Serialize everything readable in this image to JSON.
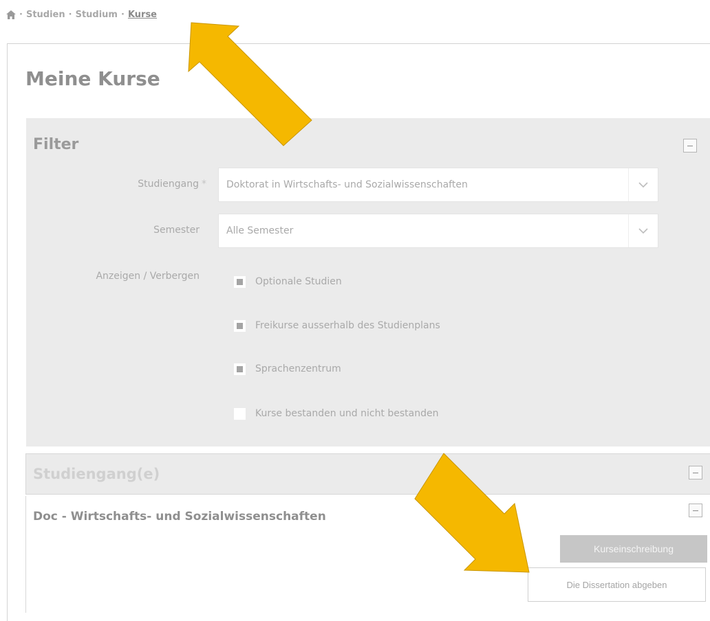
{
  "breadcrumb": {
    "separator": "·",
    "items": [
      "Studien",
      "Studium"
    ],
    "current": "Kurse"
  },
  "page": {
    "title": "Meine Kurse"
  },
  "filter": {
    "title": "Filter",
    "studiengang": {
      "label": "Studiengang",
      "required_mark": "*",
      "value": "Doktorat in Wirtschafts- und Sozialwissenschaften"
    },
    "semester": {
      "label": "Semester",
      "value": "Alle Semester"
    },
    "toggle_label": "Anzeigen / Verbergen",
    "options": [
      {
        "label": "Optionale Studien",
        "checked": true
      },
      {
        "label": "Freikurse ausserhalb des Studienplans",
        "checked": true
      },
      {
        "label": "Sprachenzentrum",
        "checked": true
      },
      {
        "label": "Kurse bestanden und nicht bestanden",
        "checked": false
      }
    ]
  },
  "studiengaenge": {
    "title": "Studiengang(e)",
    "course_title": "Doc - Wirtschafts- und Sozialwissenschaften",
    "enroll_button": "Kurseinschreibung",
    "submit_button": "Die Dissertation abgeben"
  },
  "annotations": {
    "arrow_color": "#f5b800"
  },
  "icons": {
    "home": "home-icon",
    "collapse": "minus-icon",
    "dropdown": "chevron-down-icon",
    "arrow": "arrow-icon"
  }
}
